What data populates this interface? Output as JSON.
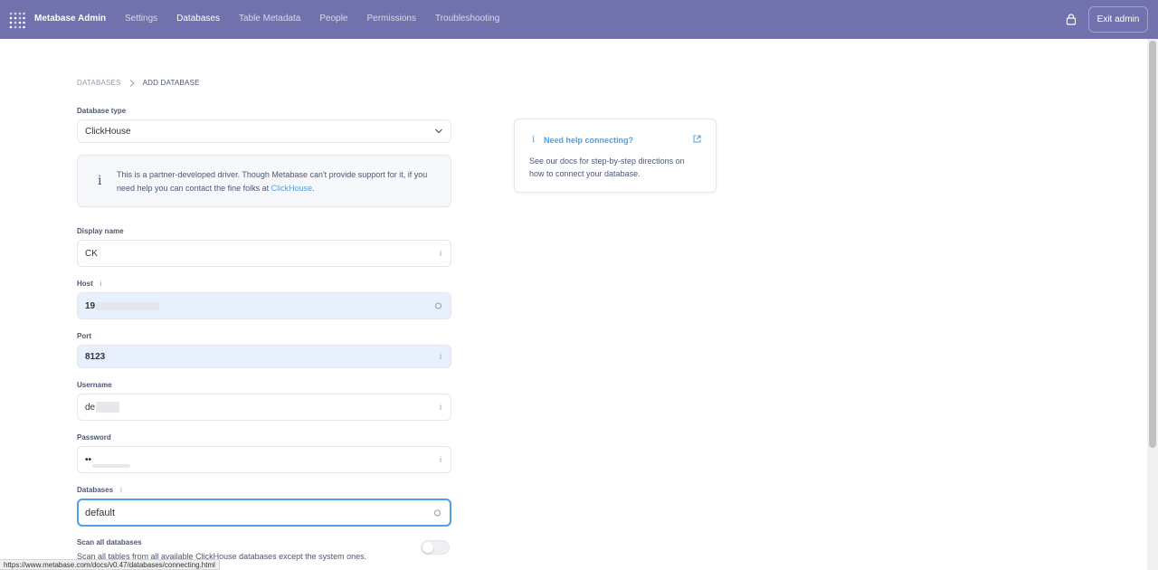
{
  "nav": {
    "brand": "Metabase Admin",
    "links": [
      "Settings",
      "Databases",
      "Table Metadata",
      "People",
      "Permissions",
      "Troubleshooting"
    ],
    "active": "Databases",
    "exit_label": "Exit admin",
    "accent": "#7172ad"
  },
  "breadcrumb": {
    "root": "DATABASES",
    "current": "ADD DATABASE"
  },
  "form": {
    "db_type_label": "Database type",
    "db_type_value": "ClickHouse",
    "notice": {
      "text": "This is a partner-developed driver. Though Metabase can't provide support for it, if you need help you can contact the fine folks at",
      "link": "ClickHouse",
      "suffix": "."
    },
    "display_name_label": "Display name",
    "display_name_value": "CK",
    "host_label": "Host",
    "host_value": "19",
    "port_label": "Port",
    "port_value": "8123",
    "username_label": "Username",
    "username_value": "de",
    "password_label": "Password",
    "password_value": "••",
    "databases_label": "Databases",
    "databases_value": "default",
    "scan_all_label": "Scan all databases",
    "scan_all_desc": "Scan all tables from all available ClickHouse databases except the system ones."
  },
  "help": {
    "title": "Need help connecting?",
    "desc": "See our docs for step-by-step directions on how to connect your database."
  },
  "status_url": "https://www.metabase.com/docs/v0.47/databases/connecting.html"
}
